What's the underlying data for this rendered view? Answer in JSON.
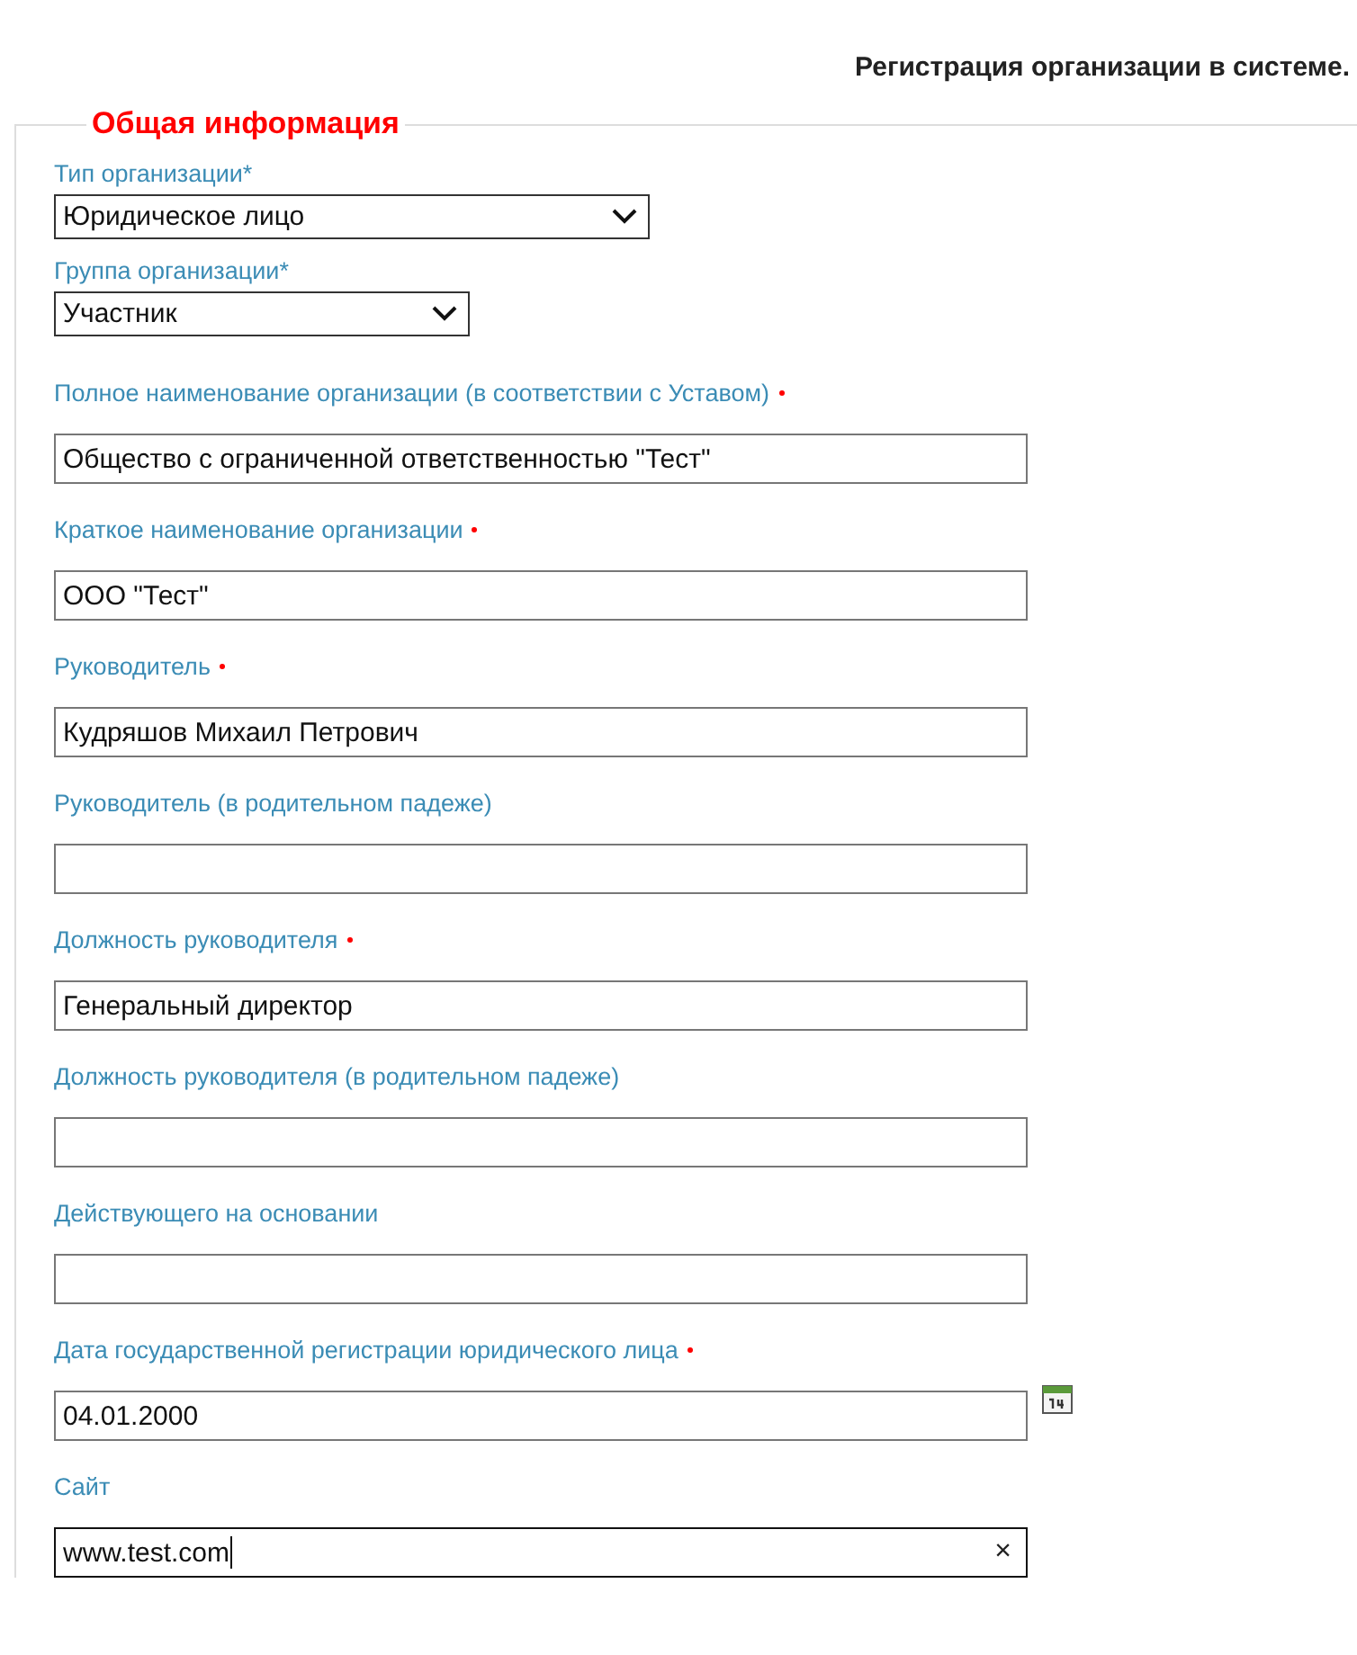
{
  "page_title": "Регистрация организации в системе.",
  "section": {
    "legend": "Общая информация",
    "fields": [
      {
        "kind": "select",
        "label": "Тип организации*",
        "value": "Юридическое лицо"
      },
      {
        "kind": "select",
        "label": "Группа организации*",
        "value": "Участник"
      },
      {
        "kind": "text",
        "label": "Полное наименование организации (в соответствии с Уставом)",
        "value": "Общество с ограниченной ответственностью \"Тест\"",
        "required": true
      },
      {
        "kind": "text",
        "label": "Краткое наименование организации",
        "value": "ООО \"Тест\"",
        "required": true
      },
      {
        "kind": "text",
        "label": "Руководитель",
        "value": "Кудряшов Михаил Петрович",
        "required": true
      },
      {
        "kind": "text",
        "label": "Руководитель (в родительном падеже)"
      },
      {
        "kind": "text",
        "label": "Должность руководителя",
        "value": "Генеральный директор",
        "required": true
      },
      {
        "kind": "text",
        "label": "Должность руководителя (в родительном падеже)"
      },
      {
        "kind": "text",
        "label": "Действующего на основании"
      },
      {
        "kind": "date",
        "label": "Дата государственной регистрации юридического лица",
        "value": "04.01.2000",
        "required": true
      },
      {
        "kind": "text",
        "label": "Сайт",
        "value": "www.test.com",
        "focused": true,
        "clear_button": "×"
      }
    ]
  }
}
